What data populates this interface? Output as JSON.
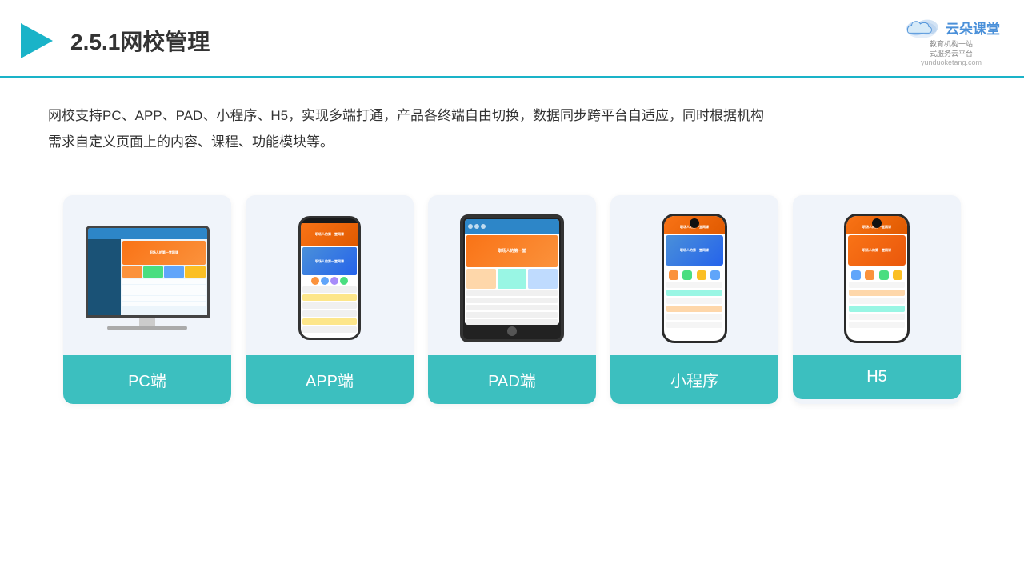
{
  "header": {
    "title": "2.5.1网校管理",
    "logo_name": "云朵课堂",
    "logo_url": "yunduoketang.com",
    "logo_tagline": "教育机构一站\n式服务云平台"
  },
  "description": {
    "text1": "网校支持PC、APP、PAD、小程序、H5，实现多端打通，产品各终端自由切换，数据同步跨平台自适应，同时根据机构",
    "text2": "需求自定义页面上的内容、课程、功能模块等。"
  },
  "cards": [
    {
      "label": "PC端",
      "id": "pc"
    },
    {
      "label": "APP端",
      "id": "app"
    },
    {
      "label": "PAD端",
      "id": "pad"
    },
    {
      "label": "小程序",
      "id": "mini"
    },
    {
      "label": "H5",
      "id": "h5"
    }
  ]
}
